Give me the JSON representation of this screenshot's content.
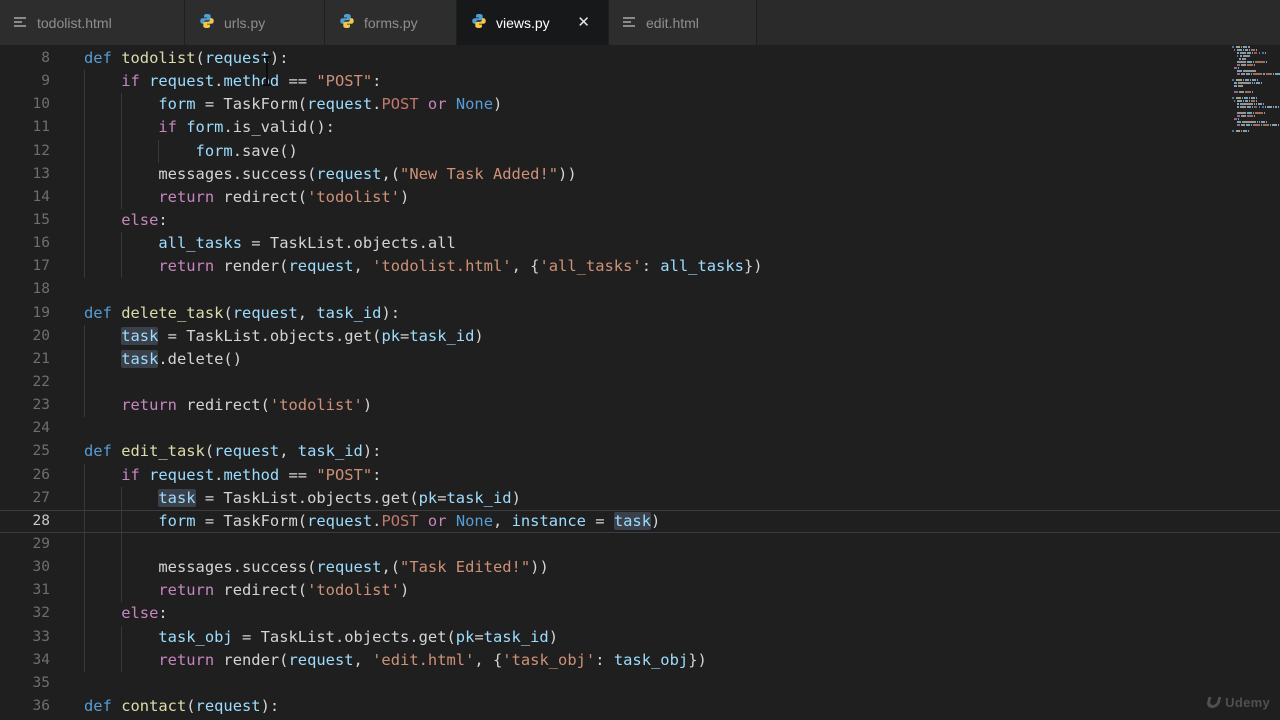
{
  "tab_bar": {
    "tabs": [
      {
        "label": "todolist.html",
        "icon": "html-file-icon",
        "active": false
      },
      {
        "label": "urls.py",
        "icon": "python-icon",
        "active": false
      },
      {
        "label": "forms.py",
        "icon": "python-icon",
        "active": false
      },
      {
        "label": "views.py",
        "icon": "python-icon",
        "active": true,
        "close_icon": "✕"
      },
      {
        "label": "edit.html",
        "icon": "html-file-icon",
        "active": false
      }
    ]
  },
  "editor": {
    "language": "python",
    "active_line": 28,
    "first_line_number": 8,
    "last_line_number": 36,
    "lines": [
      {
        "n": 8,
        "g": 0,
        "tok": [
          [
            "kw",
            "def"
          ],
          [
            "pl",
            " "
          ],
          [
            "fn",
            "todolist"
          ],
          [
            "pl",
            "("
          ],
          [
            "var",
            "request"
          ],
          [
            "pl",
            "):"
          ]
        ]
      },
      {
        "n": 9,
        "g": 1,
        "tok": [
          [
            "pl",
            "    "
          ],
          [
            "ctl",
            "if"
          ],
          [
            "pl",
            " "
          ],
          [
            "var",
            "request"
          ],
          [
            "pl",
            "."
          ],
          [
            "var",
            "method"
          ],
          [
            "pl",
            " == "
          ],
          [
            "str",
            "\"POST\""
          ],
          [
            "pl",
            ":"
          ]
        ]
      },
      {
        "n": 10,
        "g": 2,
        "tok": [
          [
            "pl",
            "        "
          ],
          [
            "var",
            "form"
          ],
          [
            "pl",
            " = TaskForm("
          ],
          [
            "var",
            "request"
          ],
          [
            "pl",
            "."
          ],
          [
            "const",
            "POST"
          ],
          [
            "pl",
            " "
          ],
          [
            "ctl",
            "or"
          ],
          [
            "pl",
            " "
          ],
          [
            "kw",
            "None"
          ],
          [
            "pl",
            ")"
          ]
        ]
      },
      {
        "n": 11,
        "g": 2,
        "tok": [
          [
            "pl",
            "        "
          ],
          [
            "ctl",
            "if"
          ],
          [
            "pl",
            " "
          ],
          [
            "var",
            "form"
          ],
          [
            "pl",
            ".is_valid():"
          ]
        ]
      },
      {
        "n": 12,
        "g": 3,
        "tok": [
          [
            "pl",
            "            "
          ],
          [
            "var",
            "form"
          ],
          [
            "pl",
            ".save()"
          ]
        ]
      },
      {
        "n": 13,
        "g": 2,
        "tok": [
          [
            "pl",
            "        "
          ],
          [
            "pl",
            "messages.success("
          ],
          [
            "var",
            "request"
          ],
          [
            "pl",
            ",("
          ],
          [
            "str",
            "\"New Task Added!\""
          ],
          [
            "pl",
            "))"
          ]
        ]
      },
      {
        "n": 14,
        "g": 2,
        "tok": [
          [
            "pl",
            "        "
          ],
          [
            "ctl",
            "return"
          ],
          [
            "pl",
            " redirect("
          ],
          [
            "str",
            "'todolist'"
          ],
          [
            "pl",
            ")"
          ]
        ]
      },
      {
        "n": 15,
        "g": 1,
        "tok": [
          [
            "pl",
            "    "
          ],
          [
            "ctl",
            "else"
          ],
          [
            "pl",
            ":"
          ]
        ]
      },
      {
        "n": 16,
        "g": 2,
        "tok": [
          [
            "pl",
            "        "
          ],
          [
            "var",
            "all_tasks"
          ],
          [
            "pl",
            " = TaskList.objects.all"
          ]
        ]
      },
      {
        "n": 17,
        "g": 2,
        "tok": [
          [
            "pl",
            "        "
          ],
          [
            "ctl",
            "return"
          ],
          [
            "pl",
            " render("
          ],
          [
            "var",
            "request"
          ],
          [
            "pl",
            ", "
          ],
          [
            "str",
            "'todolist.html'"
          ],
          [
            "pl",
            ", {"
          ],
          [
            "str",
            "'all_tasks'"
          ],
          [
            "pl",
            ": "
          ],
          [
            "var",
            "all_tasks"
          ],
          [
            "pl",
            "})"
          ]
        ]
      },
      {
        "n": 18,
        "g": 0,
        "tok": []
      },
      {
        "n": 19,
        "g": 0,
        "tok": [
          [
            "kw",
            "def"
          ],
          [
            "pl",
            " "
          ],
          [
            "fn",
            "delete_task"
          ],
          [
            "pl",
            "("
          ],
          [
            "var",
            "request"
          ],
          [
            "pl",
            ", "
          ],
          [
            "var",
            "task_id"
          ],
          [
            "pl",
            "):"
          ]
        ]
      },
      {
        "n": 20,
        "g": 1,
        "tok": [
          [
            "pl",
            "    "
          ],
          [
            "varh",
            "task"
          ],
          [
            "pl",
            " = TaskList.objects.get("
          ],
          [
            "var",
            "pk"
          ],
          [
            "pl",
            "="
          ],
          [
            "var",
            "task_id"
          ],
          [
            "pl",
            ")"
          ]
        ]
      },
      {
        "n": 21,
        "g": 1,
        "tok": [
          [
            "pl",
            "    "
          ],
          [
            "varh",
            "task"
          ],
          [
            "pl",
            ".delete()"
          ]
        ]
      },
      {
        "n": 22,
        "g": 1,
        "tok": []
      },
      {
        "n": 23,
        "g": 1,
        "tok": [
          [
            "pl",
            "    "
          ],
          [
            "ctl",
            "return"
          ],
          [
            "pl",
            " redirect("
          ],
          [
            "str",
            "'todolist'"
          ],
          [
            "pl",
            ")"
          ]
        ]
      },
      {
        "n": 24,
        "g": 0,
        "tok": []
      },
      {
        "n": 25,
        "g": 0,
        "tok": [
          [
            "kw",
            "def"
          ],
          [
            "pl",
            " "
          ],
          [
            "fn",
            "edit_task"
          ],
          [
            "pl",
            "("
          ],
          [
            "var",
            "request"
          ],
          [
            "pl",
            ", "
          ],
          [
            "var",
            "task_id"
          ],
          [
            "pl",
            "):"
          ]
        ]
      },
      {
        "n": 26,
        "g": 1,
        "tok": [
          [
            "pl",
            "    "
          ],
          [
            "ctl",
            "if"
          ],
          [
            "pl",
            " "
          ],
          [
            "var",
            "request"
          ],
          [
            "pl",
            "."
          ],
          [
            "var",
            "method"
          ],
          [
            "pl",
            " == "
          ],
          [
            "str",
            "\"POST\""
          ],
          [
            "pl",
            ":"
          ]
        ]
      },
      {
        "n": 27,
        "g": 2,
        "tok": [
          [
            "pl",
            "        "
          ],
          [
            "varh",
            "task"
          ],
          [
            "pl",
            " = TaskList.objects.get("
          ],
          [
            "var",
            "pk"
          ],
          [
            "pl",
            "="
          ],
          [
            "var",
            "task_id"
          ],
          [
            "pl",
            ")"
          ]
        ]
      },
      {
        "n": 28,
        "g": 2,
        "cur": true,
        "tok": [
          [
            "pl",
            "        "
          ],
          [
            "var",
            "form"
          ],
          [
            "pl",
            " = TaskForm("
          ],
          [
            "var",
            "request"
          ],
          [
            "pl",
            "."
          ],
          [
            "const",
            "POST"
          ],
          [
            "pl",
            " "
          ],
          [
            "ctl",
            "or"
          ],
          [
            "pl",
            " "
          ],
          [
            "kw",
            "None"
          ],
          [
            "pl",
            ", "
          ],
          [
            "var",
            "instance"
          ],
          [
            "pl",
            " = "
          ],
          [
            "varh",
            "task"
          ],
          [
            "pl",
            ")"
          ]
        ]
      },
      {
        "n": 29,
        "g": 2,
        "tok": []
      },
      {
        "n": 30,
        "g": 2,
        "tok": [
          [
            "pl",
            "        "
          ],
          [
            "pl",
            "messages.success("
          ],
          [
            "var",
            "request"
          ],
          [
            "pl",
            ",("
          ],
          [
            "str",
            "\"Task Edited!\""
          ],
          [
            "pl",
            "))"
          ]
        ]
      },
      {
        "n": 31,
        "g": 2,
        "tok": [
          [
            "pl",
            "        "
          ],
          [
            "ctl",
            "return"
          ],
          [
            "pl",
            " redirect("
          ],
          [
            "str",
            "'todolist'"
          ],
          [
            "pl",
            ")"
          ]
        ]
      },
      {
        "n": 32,
        "g": 1,
        "tok": [
          [
            "pl",
            "    "
          ],
          [
            "ctl",
            "else"
          ],
          [
            "pl",
            ":"
          ]
        ]
      },
      {
        "n": 33,
        "g": 2,
        "tok": [
          [
            "pl",
            "        "
          ],
          [
            "var",
            "task_obj"
          ],
          [
            "pl",
            " = TaskList.objects.get("
          ],
          [
            "var",
            "pk"
          ],
          [
            "pl",
            "="
          ],
          [
            "var",
            "task_id"
          ],
          [
            "pl",
            ")"
          ]
        ]
      },
      {
        "n": 34,
        "g": 2,
        "tok": [
          [
            "pl",
            "        "
          ],
          [
            "ctl",
            "return"
          ],
          [
            "pl",
            " render("
          ],
          [
            "var",
            "request"
          ],
          [
            "pl",
            ", "
          ],
          [
            "str",
            "'edit.html'"
          ],
          [
            "pl",
            ", {"
          ],
          [
            "str",
            "'task_obj'"
          ],
          [
            "pl",
            ": "
          ],
          [
            "var",
            "task_obj"
          ],
          [
            "pl",
            "})"
          ]
        ]
      },
      {
        "n": 35,
        "g": 0,
        "tok": []
      },
      {
        "n": 36,
        "g": 0,
        "tok": [
          [
            "kw",
            "def"
          ],
          [
            "pl",
            " "
          ],
          [
            "fn",
            "contact"
          ],
          [
            "pl",
            "("
          ],
          [
            "var",
            "request"
          ],
          [
            "pl",
            "):"
          ]
        ]
      }
    ]
  },
  "watermark": {
    "label": "Udemy"
  },
  "colors": {
    "editor_bg": "#1f1f1f",
    "tabbar_bg": "#2a2a2b",
    "inactive_tab_bg": "#2d2d2d",
    "active_tab_bg": "#171819",
    "keyword": "#569cd6",
    "control_keyword": "#c586c0",
    "function_name": "#dcdcaa",
    "variable": "#9cdcfe",
    "string": "#ce9178",
    "constant": "#c4776b",
    "plain_text": "#d4d4d4",
    "line_number": "#6e6e6e",
    "active_line_number": "#c6c6c6",
    "python_icon_blue": "#4d9fd6",
    "python_icon_yellow": "#f0c94a"
  }
}
